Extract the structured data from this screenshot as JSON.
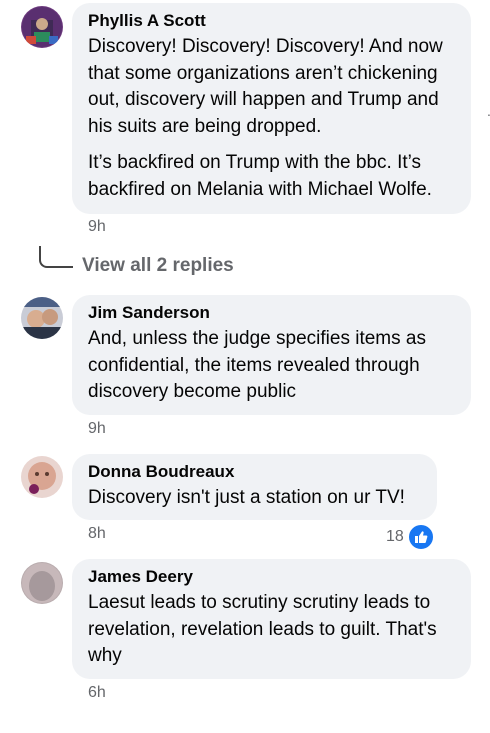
{
  "comments": [
    {
      "name": "Phyllis A Scott",
      "paragraphs": [
        "Discovery! Discovery! Discovery! And now that some organizations aren’t chickening out, discovery will happen and Trump and his suits are being dropped.",
        "It’s backfired on Trump with the bbc. It’s backfired on Melania with Michael Wolfe."
      ],
      "time": "9h"
    },
    {
      "name": "Jim Sanderson",
      "paragraphs": [
        "And, unless the judge specifies items as confidential, the items revealed through discovery become public"
      ],
      "time": "9h"
    },
    {
      "name": "Donna Boudreaux",
      "paragraphs": [
        "Discovery isn't just a station on ur TV!"
      ],
      "time": "8h",
      "reaction_count": "18",
      "reaction_icon": "like-icon"
    },
    {
      "name": "James Deery",
      "paragraphs": [
        "Laesut leads to scrutiny scrutiny leads to revelation, revelation leads to guilt. That's why"
      ],
      "time": "6h"
    }
  ],
  "view_replies_label": "View all 2 replies",
  "colors": {
    "bubble": "#f0f2f5",
    "meta": "#65676b",
    "like": "#1877f2"
  }
}
